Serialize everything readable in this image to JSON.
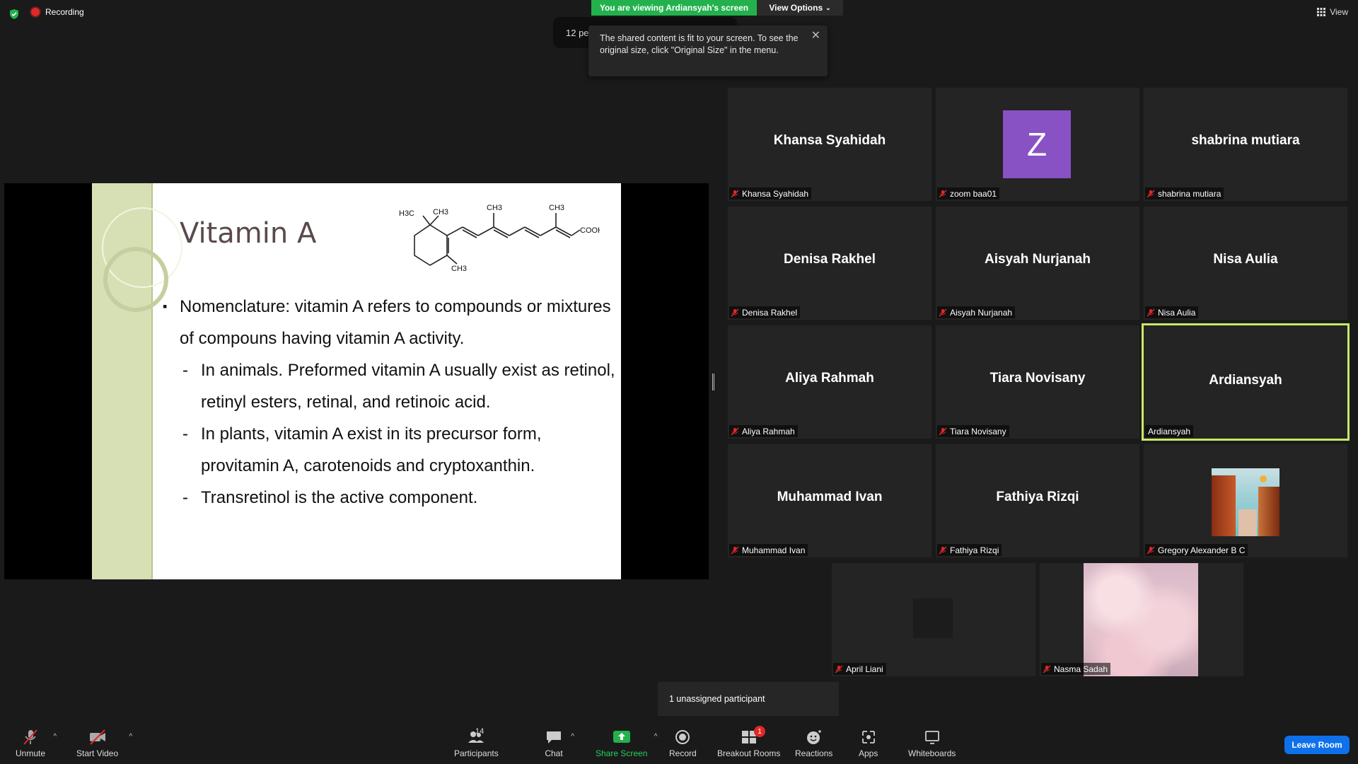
{
  "topbar": {
    "recording_label": "Recording",
    "view_label": "View",
    "viewing_banner": "You are viewing Ardiansyah's screen",
    "view_options_label": "View Options"
  },
  "waiting_room": {
    "text": "12 pe"
  },
  "tooltip": {
    "text": "The shared content is fit to your screen. To see the original size, click \"Original Size\" in the menu."
  },
  "slide": {
    "title": "Vitamin A",
    "formula": {
      "h3c": "H3C",
      "ch3_a": "CH3",
      "ch3_b": "CH3",
      "ch3_c": "CH3",
      "ch3_d": "CH3",
      "cooh": "COOH"
    },
    "bullet_main": "Nomenclature: vitamin A refers to compounds or mixtures of compouns having vitamin A activity.",
    "sub1": "In animals. Preformed vitamin A usually exist as retinol, retinyl esters, retinal, and retinoic acid.",
    "sub2": "In plants, vitamin A exist in its precursor form, provitamin A, carotenoids and cryptoxanthin.",
    "sub3": "Transretinol is the active component."
  },
  "participants": [
    {
      "name": "Khansa Syahidah",
      "label": "Khansa Syahidah"
    },
    {
      "name": "Z",
      "label": "zoom baa01"
    },
    {
      "name": "shabrina mutiara",
      "label": "shabrina mutiara"
    },
    {
      "name": "Denisa Rakhel",
      "label": "Denisa Rakhel"
    },
    {
      "name": "Aisyah Nurjanah",
      "label": "Aisyah Nurjanah"
    },
    {
      "name": "Nisa Aulia",
      "label": "Nisa Aulia"
    },
    {
      "name": "Aliya Rahmah",
      "label": "Aliya Rahmah"
    },
    {
      "name": "Tiara Novisany",
      "label": "Tiara Novisany"
    },
    {
      "name": "Ardiansyah",
      "label": "Ardiansyah"
    },
    {
      "name": "Muhammad Ivan",
      "label": "Muhammad Ivan"
    },
    {
      "name": "Fathiya Rizqi",
      "label": "Fathiya Rizqi"
    },
    {
      "name": "",
      "label": "Gregory Alexander B C"
    },
    {
      "name": "",
      "label": "April Liani"
    },
    {
      "name": "",
      "label": "Nasma Sadah"
    }
  ],
  "unassigned": "1 unassigned participant",
  "toolbar": {
    "unmute": "Unmute",
    "start_video": "Start Video",
    "participants": "Participants",
    "participants_count": "14",
    "chat": "Chat",
    "share_screen": "Share Screen",
    "record": "Record",
    "breakout_rooms": "Breakout Rooms",
    "breakout_badge": "1",
    "reactions": "Reactions",
    "apps": "Apps",
    "whiteboards": "Whiteboards",
    "leave_room": "Leave Room"
  },
  "colors": {
    "accent_green": "#23b14d",
    "active_speaker": "#c9e86b",
    "avatar_purple": "#8952c4",
    "leave_blue": "#0e71eb",
    "record_red": "#e02828"
  }
}
